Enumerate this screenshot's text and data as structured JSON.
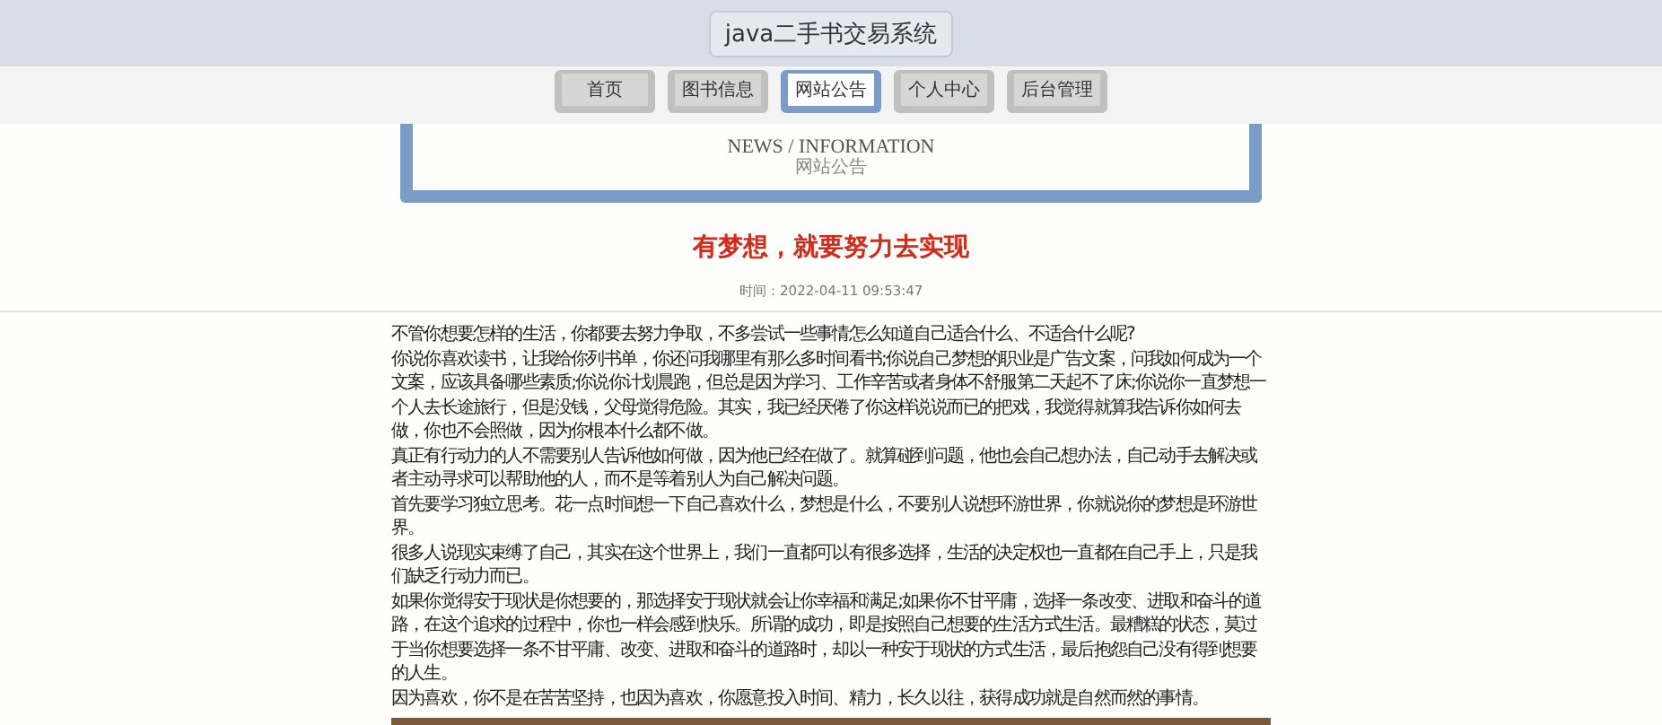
{
  "header": {
    "site_title": "java二手书交易系统"
  },
  "nav": [
    {
      "label": "首页",
      "selected": false
    },
    {
      "label": "图书信息",
      "selected": false
    },
    {
      "label": "网站公告",
      "selected": true
    },
    {
      "label": "个人中心",
      "selected": false
    },
    {
      "label": "后台管理",
      "selected": false
    }
  ],
  "section_banner": {
    "title_en": "NEWS / INFORMATION",
    "title_zh": "网站公告"
  },
  "article": {
    "title": "有梦想，就要努力去实现",
    "time": "时间：2022-04-11 09:53:47",
    "paragraphs": [
      "不管你想要怎样的生活，你都要去努力争取，不多尝试一些事情怎么知道自己适合什么、不适合什么呢?",
      "你说你喜欢读书，让我给你列书单，你还问我哪里有那么多时间看书;你说自己梦想的职业是广告文案，问我如何成为一个文案，应该具备哪些素质;你说你计划晨跑，但总是因为学习、工作辛苦或者身体不舒服第二天起不了床;你说你一直梦想一个人去长途旅行，但是没钱，父母觉得危险。其实，我已经厌倦了你这样说说而已的把戏，我觉得就算我告诉你如何去做，你也不会照做，因为你根本什么都不做。",
      "真正有行动力的人不需要别人告诉他如何做，因为他已经在做了。就算碰到问题，他也会自己想办法，自己动手去解决或者主动寻求可以帮助他的人，而不是等着别人为自己解决问题。",
      "首先要学习独立思考。花一点时间想一下自己喜欢什么，梦想是什么，不要别人说想环游世界，你就说你的梦想是环游世界。",
      "很多人说现实束缚了自己，其实在这个世界上，我们一直都可以有很多选择，生活的决定权也一直都在自己手上，只是我们缺乏行动力而已。",
      "如果你觉得安于现状是你想要的，那选择安于现状就会让你幸福和满足;如果你不甘平庸，选择一条改变、进取和奋斗的道路，在这个追求的过程中，你也一样会感到快乐。所谓的成功，即是按照自己想要的生活方式生活。最糟糕的状态，莫过于当你想要选择一条不甘平庸、改变、进取和奋斗的道路时，却以一种安于现状的方式生活，最后抱怨自己没有得到想要的人生。",
      "因为喜欢，你不是在苦苦坚持，也因为喜欢，你愿意投入时间、精力，长久以往，获得成功就是自然而然的事情。"
    ]
  }
}
